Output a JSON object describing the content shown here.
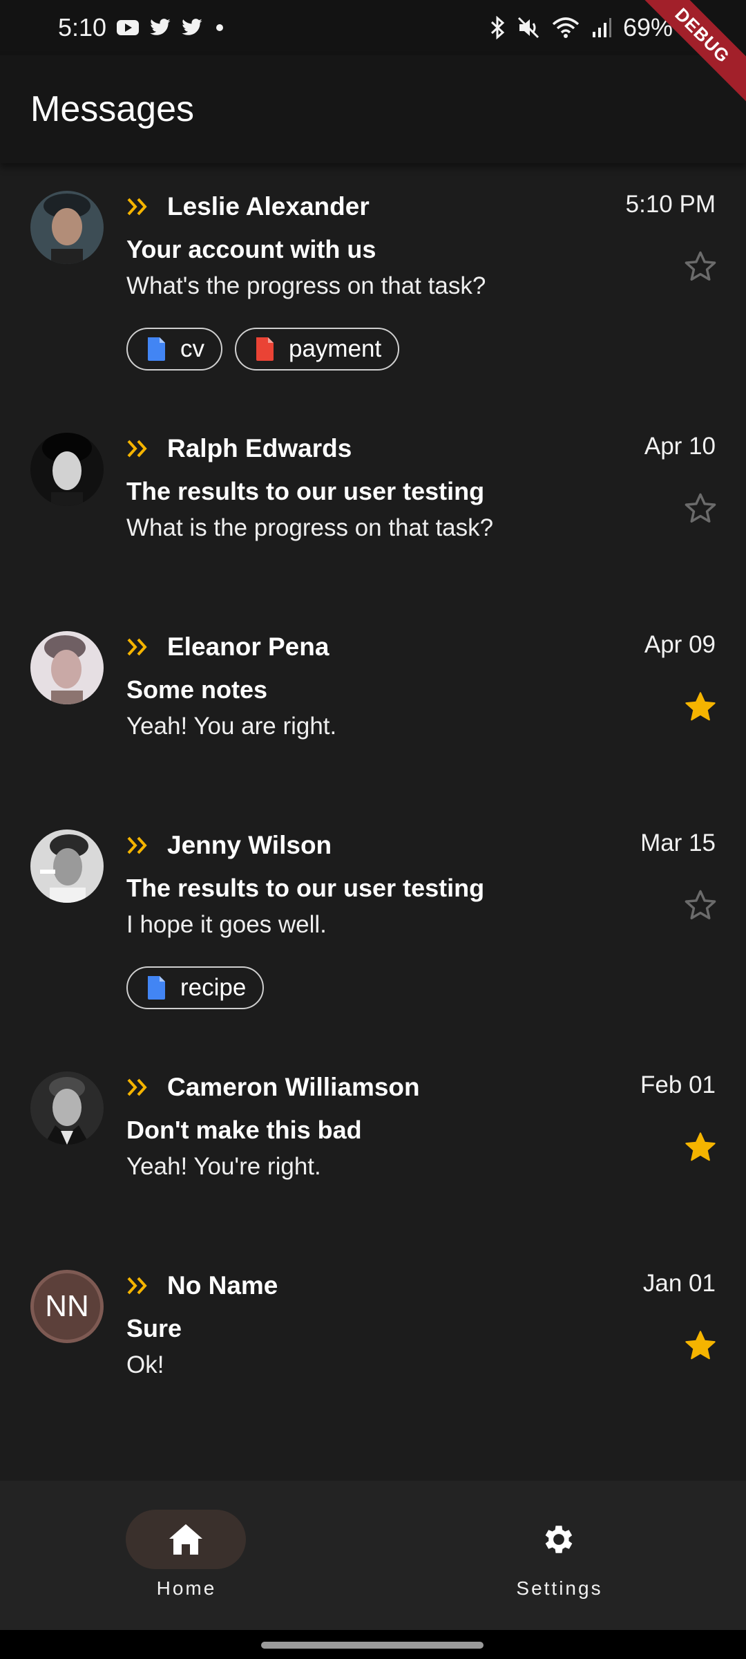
{
  "status_bar": {
    "time": "5:10",
    "battery": "69%",
    "debug_label": "DEBUG"
  },
  "app_bar": {
    "title": "Messages"
  },
  "messages": [
    {
      "sender": "Leslie Alexander",
      "date": "5:10 PM",
      "subject": "Your account with us",
      "preview": "What's the progress on that task?",
      "starred": false,
      "attachments": [
        {
          "name": "cv",
          "color": "#4285f4"
        },
        {
          "name": "payment",
          "color": "#ea4335"
        }
      ]
    },
    {
      "sender": "Ralph Edwards",
      "date": "Apr 10",
      "subject": "The results to our user testing",
      "preview": "What is the progress on that task?",
      "starred": false,
      "attachments": []
    },
    {
      "sender": "Eleanor Pena",
      "date": "Apr 09",
      "subject": "Some notes",
      "preview": "Yeah! You are right.",
      "starred": true,
      "attachments": []
    },
    {
      "sender": "Jenny Wilson",
      "date": "Mar 15",
      "subject": "The results to our user testing",
      "preview": "I hope it goes well.",
      "starred": false,
      "attachments": [
        {
          "name": "recipe",
          "color": "#4285f4"
        }
      ]
    },
    {
      "sender": "Cameron Williamson",
      "date": "Feb 01",
      "subject": "Don't make this bad",
      "preview": "Yeah! You're right.",
      "starred": true,
      "attachments": []
    },
    {
      "sender": "No Name",
      "date": "Jan 01",
      "subject": "Sure",
      "preview": "Ok!",
      "starred": true,
      "initials": "NN",
      "attachments": []
    }
  ],
  "bottom_nav": {
    "items": [
      {
        "label": "Home",
        "icon": "home-icon",
        "active": true
      },
      {
        "label": "Settings",
        "icon": "gear-icon",
        "active": false
      }
    ]
  },
  "colors": {
    "accent": "#f5b400",
    "star_off": "#6b6b6b",
    "background": "#1c1c1c"
  }
}
